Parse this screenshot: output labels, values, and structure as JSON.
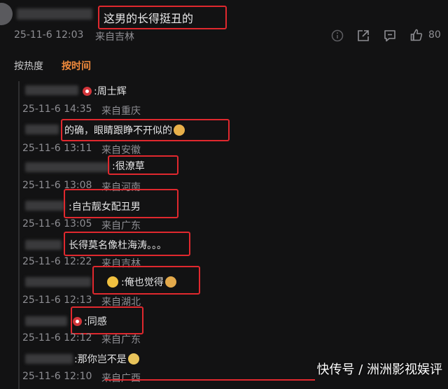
{
  "top_comment": {
    "text": "这男的长得挺丑的",
    "time": "25-11-6 12:03",
    "location": "来自吉林",
    "like_count": "80",
    "icons": [
      "info-icon",
      "share-icon",
      "comment-icon",
      "like-icon"
    ]
  },
  "tabs": [
    {
      "label": "按热度",
      "active": false
    },
    {
      "label": "按时间",
      "active": true
    }
  ],
  "replies": [
    {
      "text": ":周士辉",
      "time": "25-11-6 14:35",
      "location": "来自重庆"
    },
    {
      "text": "的确，眼睛跟睁不开似的",
      "time": "25-11-6 13:11",
      "location": "来自安徽"
    },
    {
      "text": ":很潦草",
      "time": "25-11-6 13:08",
      "location": "来自河南"
    },
    {
      "text": ":自古靓女配丑男",
      "time": "25-11-6 13:05",
      "location": "来自广东"
    },
    {
      "text": "长得莫名像杜海涛。。。",
      "time": "25-11-6 12:22",
      "location": "来自吉林"
    },
    {
      "text": ":俺也觉得",
      "time": "25-11-6 12:13",
      "location": "来自湖北"
    },
    {
      "text": ":同感",
      "time": "25-11-6 12:12",
      "location": "来自广东"
    },
    {
      "text": ":那你岂不是",
      "time": "25-11-6 12:10",
      "location": "来自广西"
    }
  ],
  "watermark": "快传号 / 洲洲影视娱评",
  "colors": {
    "background": "#121213",
    "highlight_box": "#e0282e",
    "active_tab": "#f08a3c",
    "meta_text": "#8e8e93"
  }
}
